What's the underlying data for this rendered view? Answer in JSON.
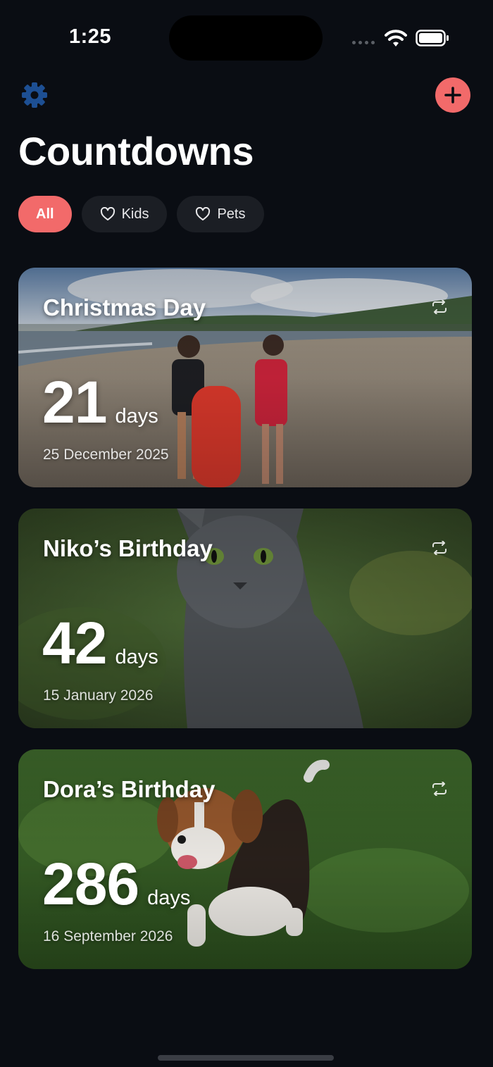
{
  "status": {
    "time": "1:25"
  },
  "header": {
    "title": "Countdowns"
  },
  "filters": [
    {
      "label": "All",
      "icon": "",
      "active": true
    },
    {
      "label": "Kids",
      "icon": "heart-outline-icon",
      "active": false
    },
    {
      "label": "Pets",
      "icon": "heart-outline-icon",
      "active": false
    }
  ],
  "events": [
    {
      "title": "Christmas Day",
      "count": "21",
      "unit": "days",
      "date": "25 December 2025",
      "repeats": true
    },
    {
      "title": "Niko’s Birthday",
      "count": "42",
      "unit": "days",
      "date": "15 January 2026",
      "repeats": true
    },
    {
      "title": "Dora’s Birthday",
      "count": "286",
      "unit": "days",
      "date": "16 September 2026",
      "repeats": true
    }
  ],
  "colors": {
    "accent": "#f26a6a",
    "settings": "#1d4f93",
    "background": "#0a0d13",
    "chip": "#1b1e24"
  }
}
